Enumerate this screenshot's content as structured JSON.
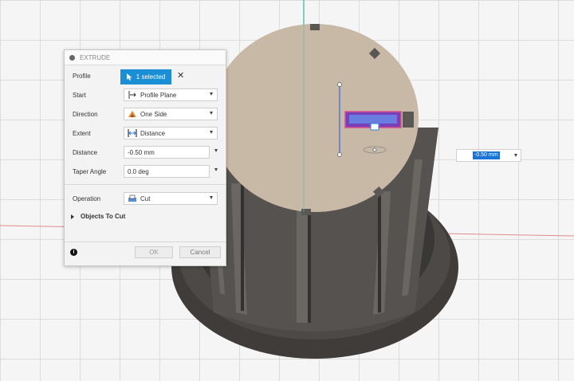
{
  "dialog": {
    "title": "EXTRUDE",
    "profile": {
      "label": "Profile",
      "selection": "1 selected",
      "clear_icon": "✕"
    },
    "start": {
      "label": "Start",
      "value": "Profile Plane",
      "icon": "profile-plane-icon"
    },
    "direction": {
      "label": "Direction",
      "value": "One Side",
      "icon": "one-side-icon"
    },
    "extent": {
      "label": "Extent",
      "value": "Distance",
      "icon": "distance-icon"
    },
    "distance": {
      "label": "Distance",
      "value": "-0.50 mm"
    },
    "taper_angle": {
      "label": "Taper Angle",
      "value": "0.0 deg"
    },
    "operation": {
      "label": "Operation",
      "value": "Cut",
      "icon": "cut-icon"
    },
    "objects_to_cut": {
      "label": "Objects To Cut"
    },
    "info_icon": "i",
    "ok_label": "OK",
    "cancel_label": "Cancel"
  },
  "viewport_input": {
    "value": "-0.50 mm"
  },
  "colors": {
    "accent": "#1a8fd6",
    "face": "#c8b8a6",
    "body": "#4a4744",
    "profile_highlight": "#7a3fb8"
  }
}
